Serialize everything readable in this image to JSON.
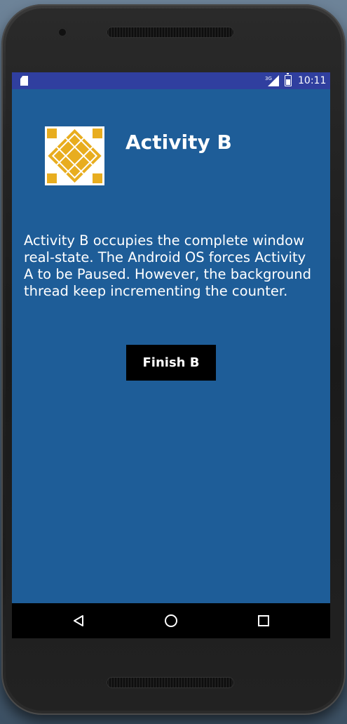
{
  "status_bar": {
    "network": "3G",
    "time": "10:11"
  },
  "activity": {
    "title": "Activity B",
    "description": "Activity B occupies the complete window real-state. The Android OS forces Activity A to be Paused. However, the background thread keep incrementing the counter.",
    "finish_button_label": "Finish B"
  },
  "icons": {
    "logo": "gold-tile-logo-icon",
    "back": "back-triangle-icon",
    "home": "home-circle-icon",
    "recents": "recents-square-icon"
  },
  "colors": {
    "status_bar": "#303f9f",
    "screen_background": "#1e5d98",
    "logo_gold": "#e8ad1f",
    "button_background": "#000000",
    "nav_bar": "#000000"
  }
}
